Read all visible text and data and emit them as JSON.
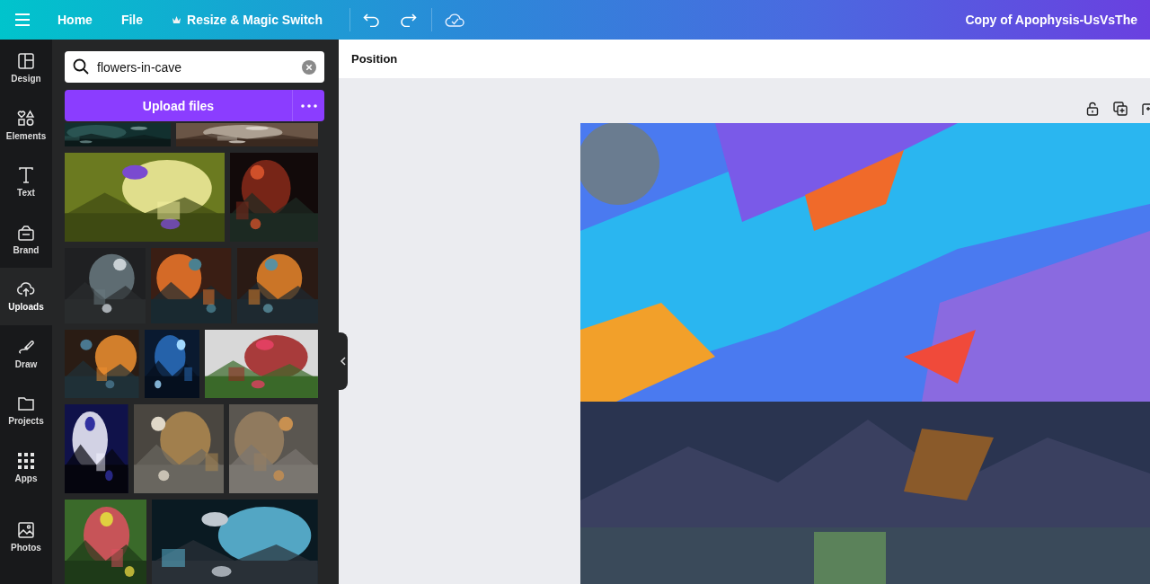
{
  "top_bar": {
    "nav": [
      {
        "label": "Home",
        "kind": "plain"
      },
      {
        "label": "File",
        "kind": "plain"
      },
      {
        "label": "Resize & Magic Switch",
        "kind": "premium"
      }
    ],
    "title": "Copy of Apophysis-UsVsThe"
  },
  "rail": [
    {
      "label": "Design",
      "selected": false
    },
    {
      "label": "Elements",
      "selected": false
    },
    {
      "label": "Text",
      "selected": false
    },
    {
      "label": "Brand",
      "selected": false
    },
    {
      "label": "Uploads",
      "selected": true
    },
    {
      "label": "Draw",
      "selected": false
    },
    {
      "label": "Projects",
      "selected": false
    },
    {
      "label": "Apps",
      "selected": false
    },
    {
      "label": "Photos",
      "selected": false
    }
  ],
  "panel": {
    "search": {
      "value": "flowers-in-cave"
    },
    "upload_button": "Upload files"
  },
  "editor": {
    "toolbar_label": "Position"
  }
}
